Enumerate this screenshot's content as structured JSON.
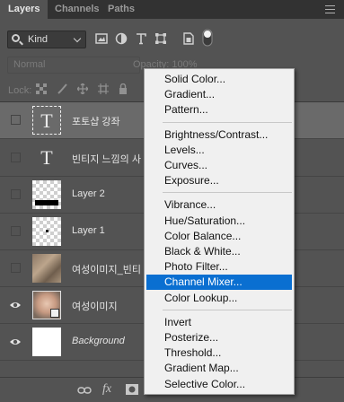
{
  "tabs": [
    {
      "label": "Layers",
      "active": true
    },
    {
      "label": "Channels",
      "active": false
    },
    {
      "label": "Paths",
      "active": false
    }
  ],
  "filter": {
    "kind_label": "Kind"
  },
  "blend": {
    "mode": "Normal",
    "opacity_label": "Opacity: 100%"
  },
  "lock": {
    "label": "Lock:"
  },
  "layers": [
    {
      "name": "포토샵 강좌",
      "type": "text",
      "visible": false,
      "selected": true
    },
    {
      "name": "빈티지 느낌의 사",
      "type": "text",
      "visible": false,
      "selected": false
    },
    {
      "name": "Layer 2",
      "type": "pixel",
      "visible": false,
      "selected": false
    },
    {
      "name": "Layer 1",
      "type": "pixel",
      "visible": false,
      "selected": false
    },
    {
      "name": "여성이미지_빈티",
      "type": "image",
      "visible": false,
      "selected": false
    },
    {
      "name": "여성이미지",
      "type": "smart",
      "visible": true,
      "selected": false
    },
    {
      "name": "Background",
      "type": "background",
      "visible": true,
      "selected": false
    }
  ],
  "menu": {
    "groups": [
      [
        "Solid Color...",
        "Gradient...",
        "Pattern..."
      ],
      [
        "Brightness/Contrast...",
        "Levels...",
        "Curves...",
        "Exposure..."
      ],
      [
        "Vibrance...",
        "Hue/Saturation...",
        "Color Balance...",
        "Black & White...",
        "Photo Filter...",
        "Channel Mixer...",
        "Color Lookup..."
      ],
      [
        "Invert",
        "Posterize...",
        "Threshold...",
        "Gradient Map...",
        "Selective Color..."
      ]
    ],
    "highlighted": "Channel Mixer..."
  },
  "colors": {
    "panel": "#535353",
    "tabbar": "#323232",
    "selected_row": "#6a6a6a",
    "menu_bg": "#f0f0f0",
    "menu_highlight": "#0a6fd1"
  }
}
